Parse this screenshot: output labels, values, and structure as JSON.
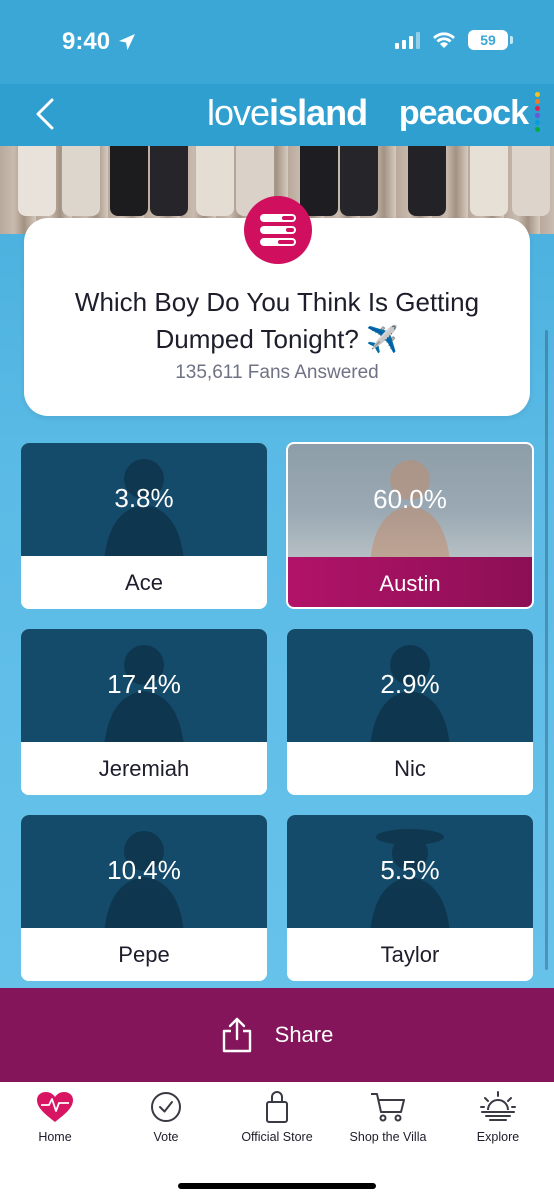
{
  "status": {
    "time": "9:40",
    "battery": "59"
  },
  "header": {
    "logo_love": "love",
    "logo_island": "island",
    "brand": "peacock"
  },
  "question": {
    "title": "Which Boy Do You Think Is Getting Dumped Tonight? ✈️",
    "fans_answered": "135,611 Fans Answered"
  },
  "options": [
    {
      "name": "Ace",
      "percent": "3.8%"
    },
    {
      "name": "Austin",
      "percent": "60.0%",
      "selected": true
    },
    {
      "name": "Jeremiah",
      "percent": "17.4%"
    },
    {
      "name": "Nic",
      "percent": "2.9%"
    },
    {
      "name": "Pepe",
      "percent": "10.4%"
    },
    {
      "name": "Taylor",
      "percent": "5.5%"
    }
  ],
  "share": {
    "label": "Share"
  },
  "tabs": [
    {
      "label": "Home",
      "icon": "heart-icon"
    },
    {
      "label": "Vote",
      "icon": "check-circle-icon"
    },
    {
      "label": "Official Store",
      "icon": "bag-icon"
    },
    {
      "label": "Shop the Villa",
      "icon": "cart-icon"
    },
    {
      "label": "Explore",
      "icon": "sunset-icon"
    }
  ],
  "colors": {
    "accent": "#d0105e",
    "share_bar": "#85155a",
    "card_dark": "#144a6a",
    "sky": "#5bbbe6"
  }
}
